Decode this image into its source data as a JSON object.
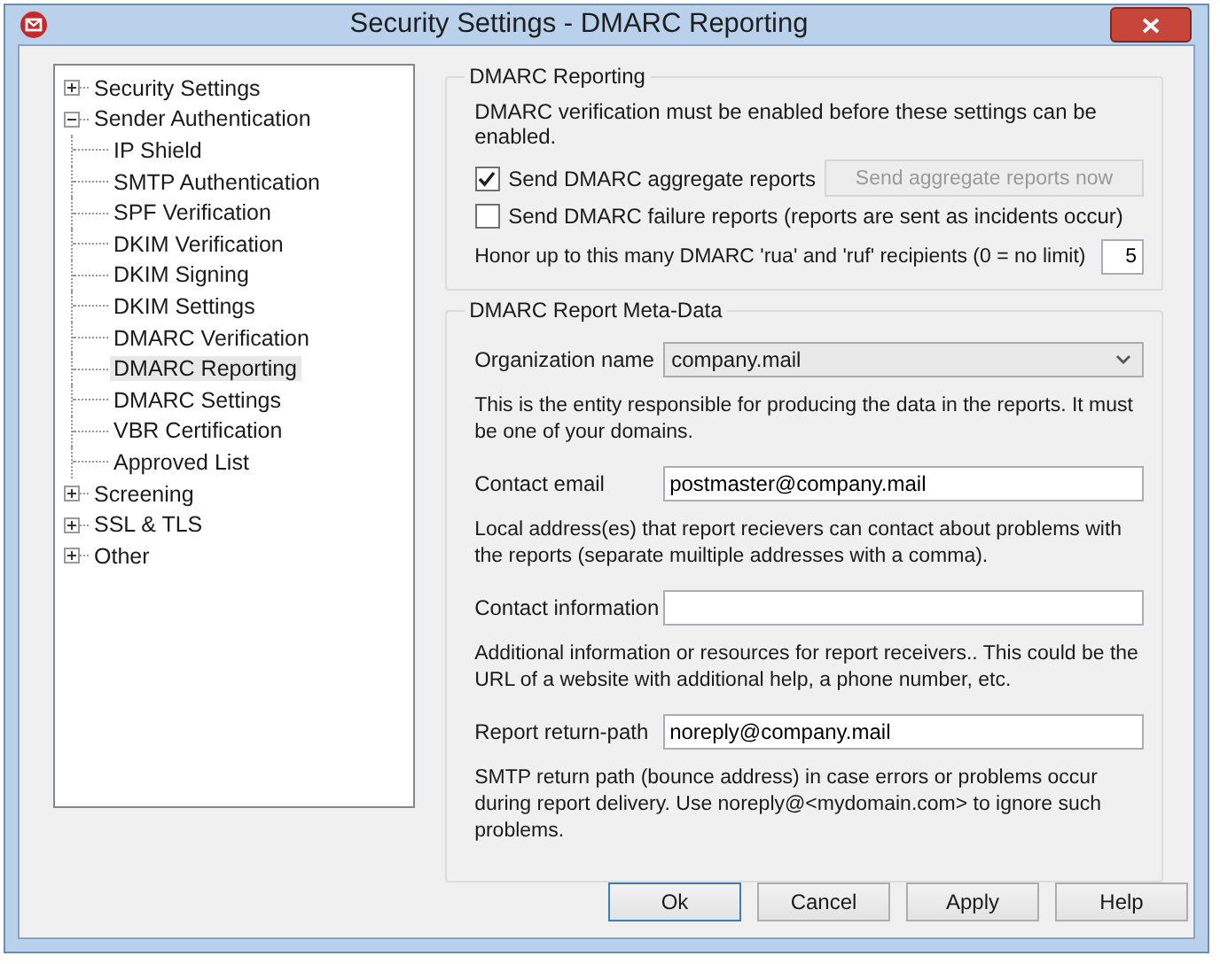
{
  "window": {
    "title": "Security Settings - DMARC Reporting"
  },
  "tree": [
    {
      "label": "Security Settings",
      "expanded": false,
      "selected": false
    },
    {
      "label": "Sender Authentication",
      "expanded": true,
      "selected": false,
      "children": [
        {
          "label": "IP Shield",
          "selected": false
        },
        {
          "label": "SMTP Authentication",
          "selected": false
        },
        {
          "label": "SPF Verification",
          "selected": false
        },
        {
          "label": "DKIM Verification",
          "selected": false
        },
        {
          "label": "DKIM Signing",
          "selected": false
        },
        {
          "label": "DKIM Settings",
          "selected": false
        },
        {
          "label": "DMARC Verification",
          "selected": false
        },
        {
          "label": "DMARC Reporting",
          "selected": true
        },
        {
          "label": "DMARC Settings",
          "selected": false
        },
        {
          "label": "VBR Certification",
          "selected": false
        },
        {
          "label": "Approved List",
          "selected": false
        }
      ]
    },
    {
      "label": "Screening",
      "expanded": false,
      "selected": false
    },
    {
      "label": "SSL & TLS",
      "expanded": false,
      "selected": false
    },
    {
      "label": "Other",
      "expanded": false,
      "selected": false
    }
  ],
  "reporting": {
    "title": "DMARC Reporting",
    "note": "DMARC verification must be enabled before these settings can be enabled.",
    "checkboxes": [
      {
        "label": "Send DMARC aggregate reports",
        "checked": true
      },
      {
        "label": "Send DMARC failure reports (reports are sent as incidents occur)",
        "checked": false
      }
    ],
    "send_now_button": {
      "label": "Send aggregate reports now",
      "disabled": true
    },
    "recipients_label": "Honor up to this many DMARC 'rua' and 'ruf' recipients (0 = no limit)",
    "recipients_value": "5"
  },
  "meta": {
    "title": "DMARC Report Meta-Data",
    "fields": [
      {
        "kind": "dropdown",
        "label": "Organization name",
        "value": "company.mail",
        "help": "This is the entity responsible for producing the data in the reports.  It must be one of your domains."
      },
      {
        "kind": "text",
        "label": "Contact email",
        "value": "postmaster@company.mail",
        "help": "Local address(es) that report recievers can contact about problems with the reports (separate muiltiple addresses with a comma)."
      },
      {
        "kind": "text",
        "label": "Contact information",
        "help": "Additional information or resources for report receivers..  This could be the URL of a website with additional help, a phone number, etc."
      },
      {
        "kind": "text",
        "label": "Report return-path",
        "value": "noreply@company.mail",
        "help": "SMTP return path (bounce address) in case errors or problems occur during report delivery.  Use noreply@<mydomain.com> to ignore such problems."
      }
    ]
  },
  "buttons": [
    {
      "label": "Ok",
      "default": true
    },
    {
      "label": "Cancel",
      "default": false
    },
    {
      "label": "Apply",
      "default": false
    },
    {
      "label": "Help",
      "default": false
    }
  ]
}
